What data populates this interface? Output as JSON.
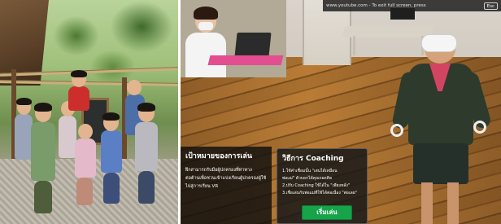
{
  "left_photo": {
    "board_text": ""
  },
  "right_photo": {
    "fullscreen_hint": {
      "text": "www.youtube.com - To exit full screen, press",
      "key_label": "Esc"
    },
    "sign_text": "",
    "goal_panel": {
      "title": "เป้าหมายของการเล่น",
      "lines": [
        "ฝึกสามารถรับมือผู้ปกครองที่ท่าทาง",
        "ต่อต้านเพื่อชวนเข้าแบ่งเรียนผู้ปกครองผู้ใช้",
        "ไปสู่การเรียน VR"
      ]
    },
    "coach_panel": {
      "title": "วิธีการ Coaching",
      "lines": [
        "1.ใช้คำเชื่อมนั้น \"เล่นได้เหมือน",
        "พ่อแม่\" ตัวบอกได้คุณรอดคิด",
        "2.ปรับ Coaching ใช้ได้ใน \"เพียงหลั่ง\"",
        "3.เชื่อเล่นกับพ่อแม่ที่ใช้ได้ต่อเนื่อง \"ต่อเลย\""
      ],
      "start_label": "เริ่มเล่น"
    }
  },
  "colors": {
    "start_button": "#16a34a",
    "panel_bg": "#0f0f0f",
    "floor_wood": "#a9702f"
  }
}
